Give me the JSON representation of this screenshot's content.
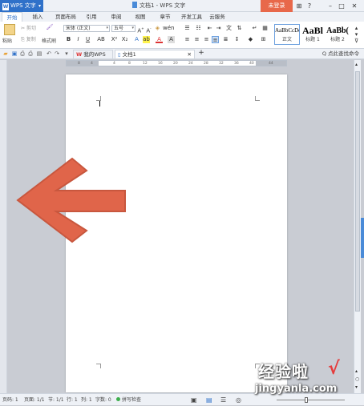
{
  "app": {
    "name": "WPS 文字",
    "window_title": "文档1 - WPS 文字",
    "login_label": "未登录"
  },
  "menu": {
    "tabs": [
      "开始",
      "插入",
      "页面布局",
      "引用",
      "审阅",
      "视图",
      "章节",
      "开发工具",
      "云服务"
    ]
  },
  "ribbon": {
    "paste_label": "粘贴",
    "cut_label": "剪切",
    "copy_label": "复制",
    "format_painter_label": "格式刷",
    "font_name": "宋体 (正文)",
    "font_size": "五号",
    "styles": [
      {
        "sample": "AaBbCcDd",
        "name": "正文"
      },
      {
        "sample": "AaBl",
        "name": "标题 1"
      },
      {
        "sample": "AaBb(",
        "name": "标题 2"
      }
    ]
  },
  "quickbar": {
    "tabs": [
      "我的WPS",
      "文档1"
    ],
    "search_help": "Q 点此查找命令"
  },
  "ruler": {
    "numbers": [
      "8",
      "4",
      "4",
      "8",
      "12",
      "16",
      "20",
      "24",
      "28",
      "32",
      "36",
      "40",
      "44"
    ]
  },
  "status": {
    "page": "页码: 1",
    "pages": "页面: 1/1",
    "section": "节: 1/1",
    "row": "行: 1",
    "col": "列: 1",
    "words": "字数: 0",
    "spell": "拼写检查"
  },
  "watermark": {
    "text": "经验啦",
    "url": "jingyanla.com",
    "check": "√"
  },
  "colors": {
    "accent": "#2f71c9",
    "login": "#e8684a",
    "arrow": "#e0654a"
  }
}
